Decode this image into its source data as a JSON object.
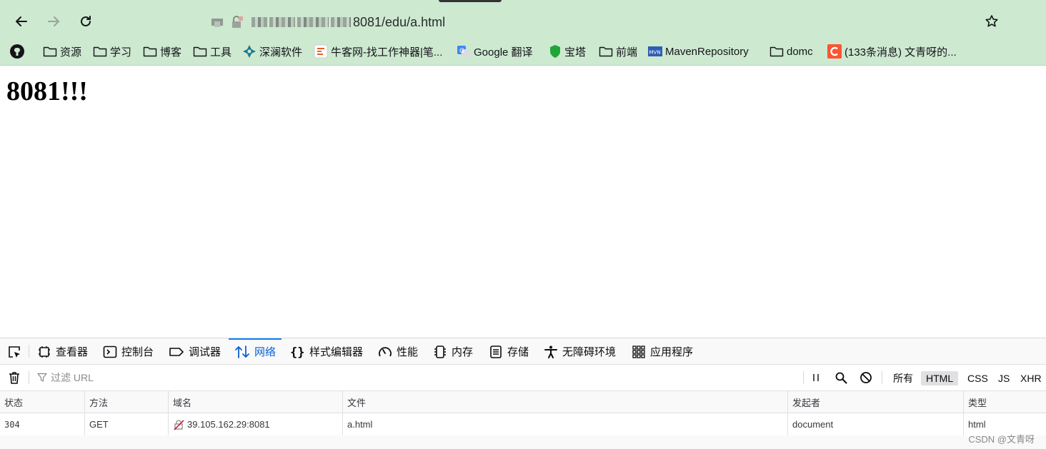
{
  "browser": {
    "url_visible": "8081/edu/a.html",
    "bookmarks": [
      {
        "label": "",
        "icon": "github-icon"
      },
      {
        "label": "资源",
        "icon": "folder-icon"
      },
      {
        "label": "学习",
        "icon": "folder-icon"
      },
      {
        "label": "博客",
        "icon": "folder-icon"
      },
      {
        "label": "工具",
        "icon": "folder-icon"
      },
      {
        "label": "深澜软件",
        "icon": "srun-icon"
      },
      {
        "label": "牛客网-找工作神器|笔...",
        "icon": "nowcoder-icon"
      },
      {
        "label": "Google 翻译",
        "icon": "google-translate-icon"
      },
      {
        "label": "宝塔",
        "icon": "bt-icon"
      },
      {
        "label": "前端",
        "icon": "folder-icon"
      },
      {
        "label": "MavenRepository",
        "icon": "mvn-icon"
      },
      {
        "label": "domc",
        "icon": "folder-icon"
      },
      {
        "label": "(133条消息) 文青呀的...",
        "icon": "csdn-icon"
      }
    ],
    "accent": "#cde9d0"
  },
  "page": {
    "heading": "8081!!!"
  },
  "devtools": {
    "tabs": [
      {
        "label": "查看器",
        "icon": "inspector-icon"
      },
      {
        "label": "控制台",
        "icon": "console-icon"
      },
      {
        "label": "调试器",
        "icon": "debugger-icon"
      },
      {
        "label": "网络",
        "icon": "network-icon",
        "active": true
      },
      {
        "label": "样式编辑器",
        "icon": "style-editor-icon"
      },
      {
        "label": "性能",
        "icon": "performance-icon"
      },
      {
        "label": "内存",
        "icon": "memory-icon"
      },
      {
        "label": "存储",
        "icon": "storage-icon"
      },
      {
        "label": "无障碍环境",
        "icon": "accessibility-icon"
      },
      {
        "label": "应用程序",
        "icon": "application-icon"
      }
    ],
    "filter_placeholder": "过滤 URL",
    "type_filters": [
      {
        "label": "所有",
        "selected": false
      },
      {
        "label": "HTML",
        "selected": true
      },
      {
        "label": "CSS",
        "selected": false
      },
      {
        "label": "JS",
        "selected": false
      },
      {
        "label": "XHR",
        "selected": false
      }
    ],
    "columns": [
      "状态",
      "方法",
      "域名",
      "文件",
      "发起者",
      "类型"
    ],
    "rows": [
      {
        "status": "304",
        "method": "GET",
        "domain": "39.105.162.29:8081",
        "file": "a.html",
        "initiator": "document",
        "type": "html"
      }
    ],
    "active_color": "#0a84ff"
  },
  "watermark": "CSDN @文青呀"
}
